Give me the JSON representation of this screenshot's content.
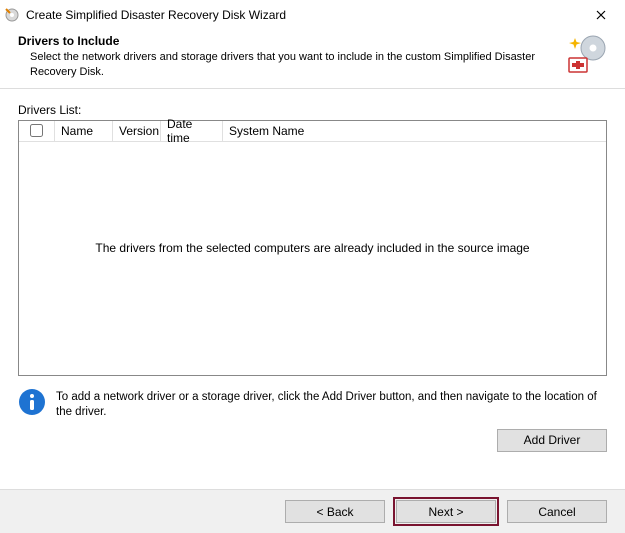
{
  "window": {
    "title": "Create Simplified Disaster Recovery Disk Wizard"
  },
  "header": {
    "title": "Drivers to Include",
    "description": "Select the network drivers and storage drivers that you want to include in the custom Simplified Disaster Recovery Disk."
  },
  "list": {
    "label": "Drivers List:",
    "columns": {
      "name": "Name",
      "version": "Version",
      "datetime": "Date time",
      "system_name": "System Name"
    },
    "rows": [],
    "empty_message": "The drivers from the selected computers are already included in the source image"
  },
  "info": {
    "text": "To add a network driver or a storage driver, click the Add Driver button, and then navigate to the location of the driver."
  },
  "buttons": {
    "add_driver": "Add Driver",
    "back": "< Back",
    "next": "Next >",
    "cancel": "Cancel"
  }
}
